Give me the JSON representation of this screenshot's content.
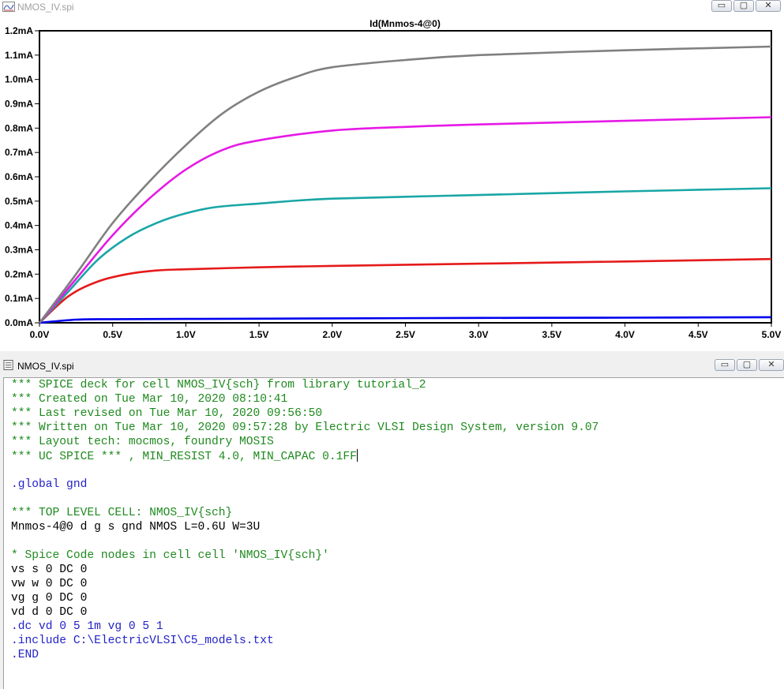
{
  "top_window": {
    "title": "NMOS_IV.spi",
    "buttons": {
      "minimize": "▭",
      "maximize": "▢",
      "close": "✕"
    }
  },
  "chart_data": {
    "type": "line",
    "title": "Id(Mnmos-4@0)",
    "xlim": [
      0,
      5
    ],
    "ylim": [
      0,
      1.2
    ],
    "x_ticks": [
      "0.0V",
      "0.5V",
      "1.0V",
      "1.5V",
      "2.0V",
      "2.5V",
      "3.0V",
      "3.5V",
      "4.0V",
      "4.5V",
      "5.0V"
    ],
    "y_ticks": [
      "0.0mA",
      "0.1mA",
      "0.2mA",
      "0.3mA",
      "0.4mA",
      "0.5mA",
      "0.6mA",
      "0.7mA",
      "0.8mA",
      "0.9mA",
      "1.0mA",
      "1.1mA",
      "1.2mA"
    ],
    "x_units": "V",
    "y_units": "mA",
    "grid": false,
    "series": [
      {
        "color": "#0000ee",
        "x": [
          0,
          0.25,
          0.5,
          1,
          2,
          3,
          4,
          5
        ],
        "values": [
          0,
          0.013,
          0.015,
          0.016,
          0.018,
          0.02,
          0.021,
          0.023
        ]
      },
      {
        "color": "#e51a1a",
        "x": [
          0,
          0.2,
          0.4,
          0.6,
          0.8,
          1,
          1.5,
          2,
          3,
          4,
          5
        ],
        "values": [
          0,
          0.11,
          0.17,
          0.2,
          0.215,
          0.22,
          0.228,
          0.234,
          0.243,
          0.252,
          0.262
        ]
      },
      {
        "color": "#19a6a6",
        "x": [
          0,
          0.2,
          0.4,
          0.6,
          0.8,
          1,
          1.2,
          1.5,
          2,
          3,
          4,
          5
        ],
        "values": [
          0,
          0.13,
          0.26,
          0.35,
          0.41,
          0.45,
          0.475,
          0.49,
          0.51,
          0.525,
          0.54,
          0.553
        ]
      },
      {
        "color": "#e619e6",
        "x": [
          0,
          0.25,
          0.5,
          0.75,
          1,
          1.25,
          1.5,
          2,
          2.5,
          3,
          4,
          5
        ],
        "values": [
          0,
          0.18,
          0.36,
          0.51,
          0.63,
          0.71,
          0.75,
          0.79,
          0.805,
          0.815,
          0.83,
          0.845
        ]
      },
      {
        "color": "#808080",
        "x": [
          0,
          0.25,
          0.5,
          0.75,
          1,
          1.25,
          1.5,
          1.75,
          2,
          2.5,
          3,
          4,
          5
        ],
        "values": [
          0,
          0.2,
          0.41,
          0.58,
          0.73,
          0.86,
          0.95,
          1.01,
          1.05,
          1.08,
          1.1,
          1.12,
          1.135
        ]
      }
    ]
  },
  "bottom_window": {
    "title": "NMOS_IV.spi",
    "buttons": {
      "minimize": "▭",
      "maximize": "▢",
      "close": "✕"
    }
  },
  "code_lines": [
    {
      "text": "*** SPICE deck for cell NMOS_IV{sch} from library tutorial_2",
      "kind": "comment"
    },
    {
      "text": "*** Created on Tue Mar 10, 2020 08:10:41",
      "kind": "comment"
    },
    {
      "text": "*** Last revised on Tue Mar 10, 2020 09:56:50",
      "kind": "comment"
    },
    {
      "text": "*** Written on Tue Mar 10, 2020 09:57:28 by Electric VLSI Design System, version 9.07",
      "kind": "comment"
    },
    {
      "text": "*** Layout tech: mocmos, foundry MOSIS",
      "kind": "comment"
    },
    {
      "text": "*** UC SPICE *** , MIN_RESIST 4.0, MIN_CAPAC 0.1FF",
      "kind": "comment",
      "cursor": true
    },
    {
      "text": "",
      "kind": "normal"
    },
    {
      "text": ".global gnd",
      "kind": "directive"
    },
    {
      "text": "",
      "kind": "normal"
    },
    {
      "text": "*** TOP LEVEL CELL: NMOS_IV{sch}",
      "kind": "comment"
    },
    {
      "text": "Mnmos-4@0 d g s gnd NMOS L=0.6U W=3U",
      "kind": "normal"
    },
    {
      "text": "",
      "kind": "normal"
    },
    {
      "text": "* Spice Code nodes in cell cell 'NMOS_IV{sch}'",
      "kind": "comment"
    },
    {
      "text": "vs s 0 DC 0",
      "kind": "normal"
    },
    {
      "text": "vw w 0 DC 0",
      "kind": "normal"
    },
    {
      "text": "vg g 0 DC 0",
      "kind": "normal"
    },
    {
      "text": "vd d 0 DC 0",
      "kind": "normal"
    },
    {
      "text": ".dc vd 0 5 1m vg 0 5 1",
      "kind": "directive"
    },
    {
      "text": ".include C:\\ElectricVLSI\\C5_models.txt",
      "kind": "directive"
    },
    {
      "text": ".END",
      "kind": "directive"
    }
  ]
}
